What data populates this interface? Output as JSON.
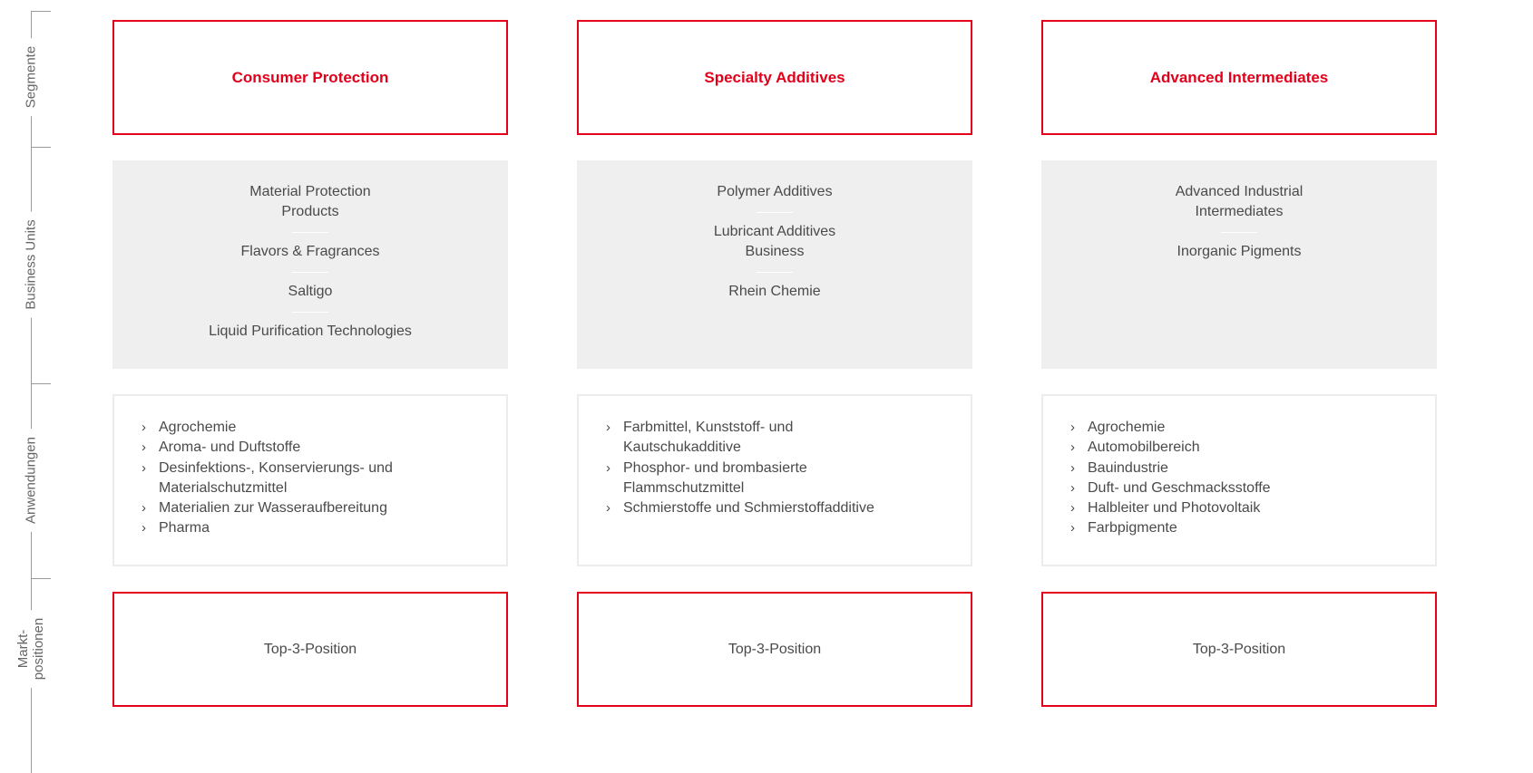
{
  "axis": {
    "segmente": "Segmente",
    "business_units": "Business Units",
    "anwendungen": "Anwendungen",
    "marktpositionen_line1": "Markt-",
    "marktpositionen_line2": "positionen"
  },
  "columns": [
    {
      "segment": "Consumer Protection",
      "business_units": [
        "Material Protection Products",
        "Flavors & Fragrances",
        "Saltigo",
        "Liquid Purification Technologies"
      ],
      "applications": [
        "Agrochemie",
        "Aroma- und Duftstoffe",
        "Desinfektions-, Konservierungs- und Materialschutzmittel",
        "Materialien zur Wasseraufbereitung",
        "Pharma"
      ],
      "market_position": "Top-3-Position"
    },
    {
      "segment": "Specialty Additives",
      "business_units": [
        "Polymer Additives",
        "Lubricant Additives Business",
        "Rhein Chemie"
      ],
      "applications": [
        "Farbmittel, Kunststoff- und Kautschukadditive",
        "Phosphor- und brombasierte Flammschutzmittel",
        "Schmierstoffe und Schmierstoffadditive"
      ],
      "market_position": "Top-3-Position"
    },
    {
      "segment": "Advanced Intermediates",
      "business_units": [
        "Advanced Industrial Intermediates",
        "Inorganic Pigments"
      ],
      "applications": [
        "Agrochemie",
        "Automobilbereich",
        "Bauindustrie",
        "Duft- und Geschmacksstoffe",
        "Halbleiter und Photovoltaik",
        "Farbpigmente"
      ],
      "market_position": "Top-3-Position"
    }
  ],
  "colors": {
    "accent": "#e2001a",
    "panel": "#efefef",
    "border_light": "#ececec",
    "text": "#4a4a4a"
  }
}
